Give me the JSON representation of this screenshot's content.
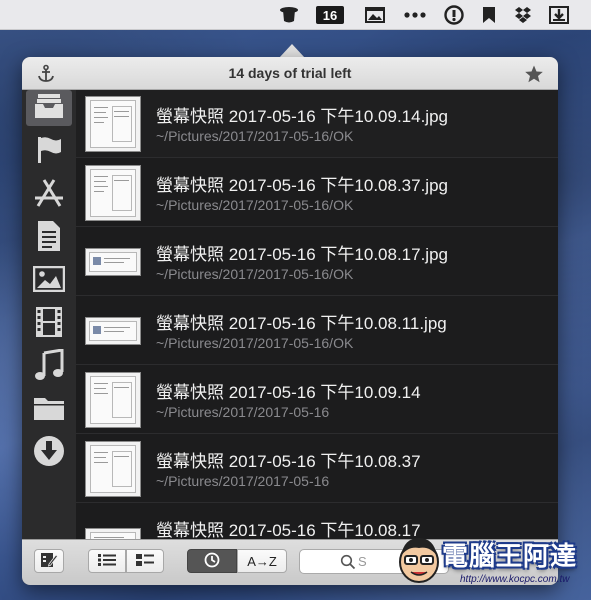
{
  "menubar": {
    "badge_number": "16",
    "icons": [
      "hat-icon",
      "calendar-badge-icon",
      "image-icon",
      "more-icon",
      "info-circle-icon",
      "bookmark-icon",
      "dropbox-icon",
      "download-icon"
    ]
  },
  "popover": {
    "title": "14 days of trial left",
    "left_icon": "anchor-icon",
    "right_icon": "star-icon"
  },
  "sidebar": {
    "items": [
      {
        "name": "inbox",
        "icon": "inbox-tray-icon",
        "active": true
      },
      {
        "name": "flagged",
        "icon": "flag-icon",
        "active": false
      },
      {
        "name": "apps",
        "icon": "app-store-icon",
        "active": false
      },
      {
        "name": "documents",
        "icon": "document-icon",
        "active": false
      },
      {
        "name": "images",
        "icon": "image-icon",
        "active": false
      },
      {
        "name": "movies",
        "icon": "film-icon",
        "active": false
      },
      {
        "name": "music",
        "icon": "music-note-icon",
        "active": false
      },
      {
        "name": "folders",
        "icon": "folder-icon",
        "active": false
      },
      {
        "name": "downloads",
        "icon": "download-circle-icon",
        "active": false
      }
    ]
  },
  "files": [
    {
      "name": "螢幕快照 2017-05-16 下午10.09.14.jpg",
      "path": "~/Pictures/2017/2017-05-16/OK"
    },
    {
      "name": "螢幕快照 2017-05-16 下午10.08.37.jpg",
      "path": "~/Pictures/2017/2017-05-16/OK"
    },
    {
      "name": "螢幕快照 2017-05-16 下午10.08.17.jpg",
      "path": "~/Pictures/2017/2017-05-16/OK"
    },
    {
      "name": "螢幕快照 2017-05-16 下午10.08.11.jpg",
      "path": "~/Pictures/2017/2017-05-16/OK"
    },
    {
      "name": "螢幕快照 2017-05-16 下午10.09.14",
      "path": "~/Pictures/2017/2017-05-16"
    },
    {
      "name": "螢幕快照 2017-05-16 下午10.08.37",
      "path": "~/Pictures/2017/2017-05-16"
    },
    {
      "name": "螢幕快照 2017-05-16 下午10.08.17",
      "path": ""
    }
  ],
  "toolbar": {
    "sort_az_label": "A→Z",
    "search_placeholder": "S"
  },
  "watermark": {
    "text": "電腦王阿達",
    "url": "http://www.kocpc.com.tw"
  }
}
